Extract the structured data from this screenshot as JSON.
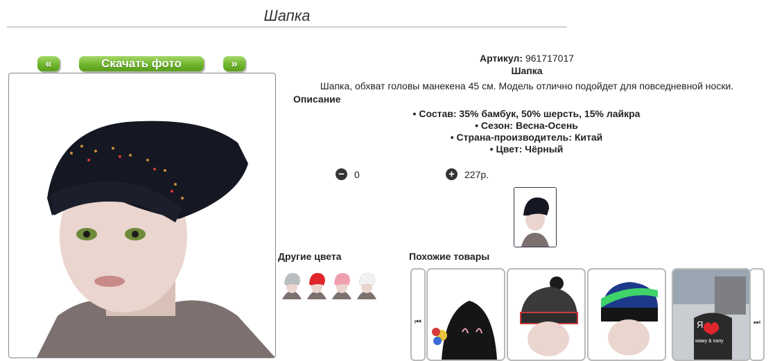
{
  "page": {
    "title": "Шапка"
  },
  "gallery": {
    "prev_label": "«",
    "download_label": "Скачать фото",
    "next_label": "»"
  },
  "product": {
    "article_label": "Артикул:",
    "article_value": "961717017",
    "name": "Шапка",
    "description": "Шапка, обхват головы манекена 45 см. Модель отлично подойдет для повседневной носки.",
    "specs_heading": "Описание",
    "specs": [
      "Состав: 35% бамбук, 50% шерсть, 15% лайкра",
      "Сезон: Весна-Осень",
      "Страна-производитель: Китай",
      "Цвет: Чёрный"
    ]
  },
  "cart": {
    "minus_icon": "minus-icon",
    "quantity": "0",
    "plus_icon": "plus-icon",
    "price": "227р."
  },
  "other_colors": {
    "heading": "Другие цвета",
    "swatches": [
      "#b9bcc0",
      "#e0262b",
      "#ef9fb0",
      "#f2f2f2"
    ]
  },
  "similar": {
    "heading": "Похожие товары",
    "card_colors": [
      "#151515",
      "#3a3a3a",
      "#1d3a8a",
      "#2a2a2a"
    ],
    "card3_text": [
      "Я",
      "маму & папу"
    ]
  }
}
